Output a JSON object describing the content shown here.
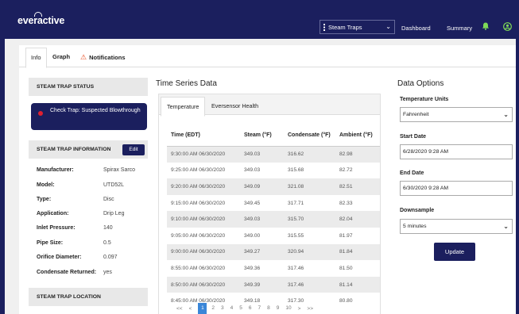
{
  "header": {
    "logo": "everactive",
    "selector": "Steam Traps",
    "nav": [
      "Dashboard",
      "Summary"
    ],
    "icons": [
      "bell-icon",
      "user-icon"
    ]
  },
  "tabs": [
    "Info",
    "Graph",
    "Notifications"
  ],
  "left": {
    "status_title": "STEAM TRAP STATUS",
    "status_text": "Check Trap: Suspected Blowthrough",
    "info_title": "STEAM TRAP INFORMATION",
    "edit_label": "Edit",
    "info": [
      {
        "k": "Manufacturer:",
        "v": "Spirax Sarco"
      },
      {
        "k": "Model:",
        "v": "UTD52L"
      },
      {
        "k": "Type:",
        "v": "Disc"
      },
      {
        "k": "Application:",
        "v": "Drip Leg"
      },
      {
        "k": "Inlet Pressure:",
        "v": "140"
      },
      {
        "k": "Pipe Size:",
        "v": "0.5"
      },
      {
        "k": "Orifice Diameter:",
        "v": "0.097"
      },
      {
        "k": "Condensate Returned:",
        "v": "yes"
      }
    ],
    "location_title": "STEAM TRAP LOCATION"
  },
  "timeseries": {
    "title": "Time Series Data",
    "tabs": [
      "Temperature",
      "Eversensor Health"
    ],
    "columns": [
      "Time (EDT)",
      "Steam (°F)",
      "Condensate (°F)",
      "Ambient (°F)"
    ],
    "rows": [
      [
        "9:30:00 AM 06/30/2020",
        "349.03",
        "316.62",
        "82.98"
      ],
      [
        "9:25:00 AM 06/30/2020",
        "349.03",
        "315.68",
        "82.72"
      ],
      [
        "9:20:00 AM 06/30/2020",
        "349.09",
        "321.08",
        "82.51"
      ],
      [
        "9:15:00 AM 06/30/2020",
        "349.45",
        "317.71",
        "82.33"
      ],
      [
        "9:10:00 AM 06/30/2020",
        "349.03",
        "315.70",
        "82.04"
      ],
      [
        "9:05:00 AM 06/30/2020",
        "349.00",
        "315.55",
        "81.97"
      ],
      [
        "9:00:00 AM 06/30/2020",
        "349.27",
        "320.94",
        "81.84"
      ],
      [
        "8:55:00 AM 06/30/2020",
        "349.36",
        "317.46",
        "81.50"
      ],
      [
        "8:50:00 AM 06/30/2020",
        "349.39",
        "317.46",
        "81.14"
      ],
      [
        "8:45:00 AM 06/30/2020",
        "349.18",
        "317.30",
        "80.80"
      ]
    ],
    "pager": {
      "first": "<<",
      "prev": "<",
      "pages": [
        "1",
        "2",
        "3",
        "4",
        "5",
        "6",
        "7",
        "8",
        "9",
        "10"
      ],
      "current": "1",
      "next": ">",
      "last": ">>"
    }
  },
  "options": {
    "title": "Data Options",
    "temp_label": "Temperature Units",
    "temp_value": "Fahrenheit",
    "start_label": "Start Date",
    "start_value": "6/28/2020 9:28 AM",
    "end_label": "End Date",
    "end_value": "6/30/2020 9:28 AM",
    "down_label": "Downsample",
    "down_value": "5 minutes",
    "update_label": "Update"
  },
  "colors": {
    "navy": "#1b1f5e",
    "alert_red": "#e02030",
    "page_blue": "#3a86d8",
    "warn_orange": "#e8491d"
  }
}
